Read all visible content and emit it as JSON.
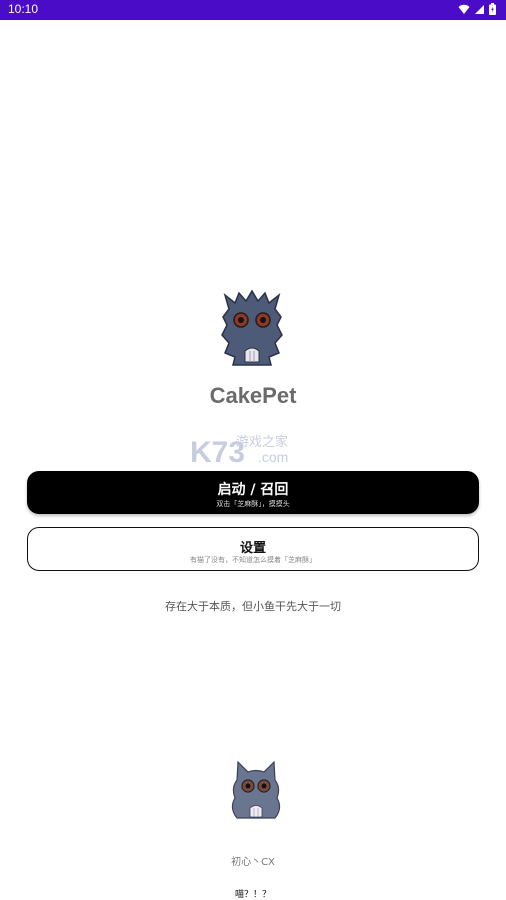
{
  "status_bar": {
    "time": "10:10",
    "icons": [
      "wifi-icon",
      "cell-signal-icon",
      "battery-icon"
    ],
    "color": "#4a0cc6"
  },
  "app": {
    "title": "CakePet"
  },
  "watermark": {
    "brand": "K73",
    "text": "游戏之家",
    "domain": ".com"
  },
  "buttons": {
    "launch": {
      "label": "启动 / 召回",
      "hint": "双击「芝麻酥」，摸摸头"
    },
    "settings": {
      "label": "设置",
      "hint": "有猫了没有，不知道怎么摸着「芝麻酥」"
    }
  },
  "tagline": "存在大于本质，但小鱼干先大于一切",
  "footer": {
    "author": "初心丶CX",
    "meow": "喵？！？"
  }
}
